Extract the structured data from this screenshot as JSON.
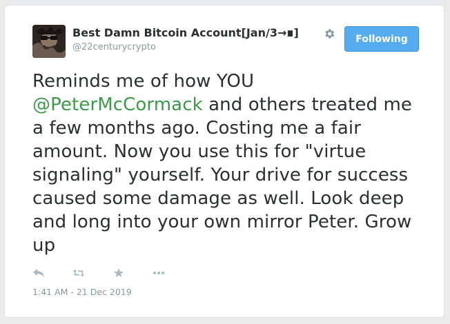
{
  "account": {
    "display_name": "Best Damn Bitcoin Account[Jan/3→∎]",
    "handle": "@22centurycrypto"
  },
  "follow_button": {
    "label": "Following"
  },
  "tweet": {
    "text_before": "Reminds me of how YOU ",
    "mention": "@PeterMcCormack",
    "text_after": " and others treated me a few months ago. Costing me a fair amount. Now you use this for \"virtue signaling\" yourself. Your drive for success caused some damage as well. Look deep and long into your own mirror Peter. Grow up",
    "timestamp": "1:41 AM - 21 Dec 2019"
  },
  "icons": [
    "settings-gear-icon",
    "reply-icon",
    "retweet-icon",
    "favorite-star-icon",
    "more-icon"
  ],
  "colors": {
    "mention": "#3b9a4a",
    "button": "#55acee",
    "muted": "#8899a6"
  }
}
